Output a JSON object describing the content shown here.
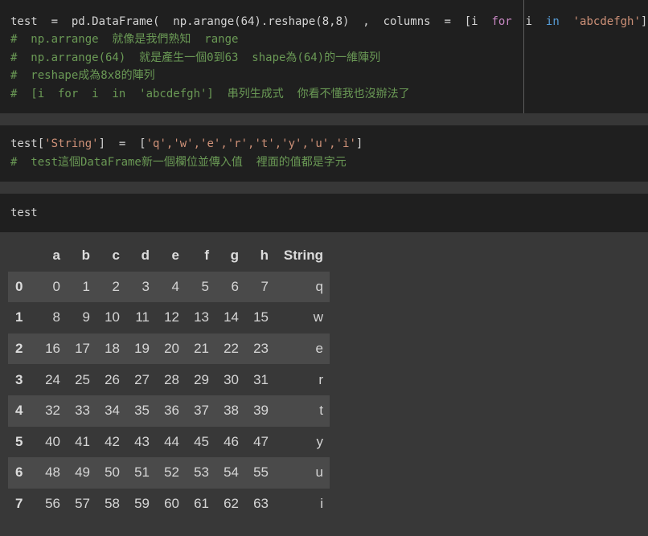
{
  "cell1": {
    "line1": {
      "a": "test  =  pd.DataFrame(  np.arange(64).reshape(8,8)  ,  columns  =  [i  ",
      "for": "for",
      "b": "  i  ",
      "in": "in",
      "c": "  ",
      "str": "'abcdefgh'",
      "d": "]  )"
    },
    "line2": "#  np.arrange  就像是我們熟知  range",
    "line3": "#  np.arrange(64)  就是產生一個0到63  shape為(64)的一維陣列",
    "line4": "#  reshape成為8x8的陣列",
    "line5": "#  [i  for  i  in  'abcdefgh']  串列生成式  你看不懂我也沒辦法了"
  },
  "cell2": {
    "line1": {
      "a": "test[",
      "s1": "'String'",
      "b": "]  =  [",
      "items": "'q','w','e','r','t','y','u','i'",
      "c": "]"
    },
    "line2": "#  test這個DataFrame新一個欄位並傳入值  裡面的值都是字元"
  },
  "cell3": {
    "line1": "test"
  },
  "table": {
    "columns": [
      "",
      "a",
      "b",
      "c",
      "d",
      "e",
      "f",
      "g",
      "h",
      "String"
    ],
    "rows": [
      {
        "idx": "0",
        "vals": [
          "0",
          "1",
          "2",
          "3",
          "4",
          "5",
          "6",
          "7"
        ],
        "s": "q"
      },
      {
        "idx": "1",
        "vals": [
          "8",
          "9",
          "10",
          "11",
          "12",
          "13",
          "14",
          "15"
        ],
        "s": "w"
      },
      {
        "idx": "2",
        "vals": [
          "16",
          "17",
          "18",
          "19",
          "20",
          "21",
          "22",
          "23"
        ],
        "s": "e"
      },
      {
        "idx": "3",
        "vals": [
          "24",
          "25",
          "26",
          "27",
          "28",
          "29",
          "30",
          "31"
        ],
        "s": "r"
      },
      {
        "idx": "4",
        "vals": [
          "32",
          "33",
          "34",
          "35",
          "36",
          "37",
          "38",
          "39"
        ],
        "s": "t"
      },
      {
        "idx": "5",
        "vals": [
          "40",
          "41",
          "42",
          "43",
          "44",
          "45",
          "46",
          "47"
        ],
        "s": "y"
      },
      {
        "idx": "6",
        "vals": [
          "48",
          "49",
          "50",
          "51",
          "52",
          "53",
          "54",
          "55"
        ],
        "s": "u"
      },
      {
        "idx": "7",
        "vals": [
          "56",
          "57",
          "58",
          "59",
          "60",
          "61",
          "62",
          "63"
        ],
        "s": "i"
      }
    ]
  }
}
